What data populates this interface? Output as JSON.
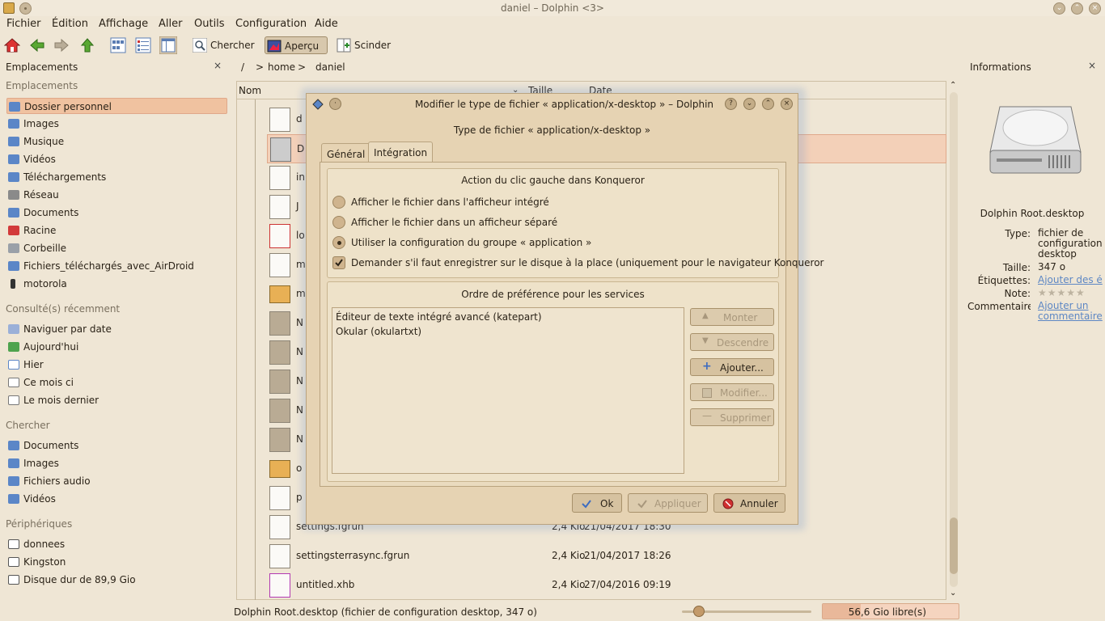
{
  "window": {
    "title": "daniel – Dolphin <3>"
  },
  "menu": [
    "Fichier",
    "Édition",
    "Affichage",
    "Aller",
    "Outils",
    "Configuration",
    "Aide"
  ],
  "toolbar": {
    "search": "Chercher",
    "preview": "Aperçu",
    "split": "Scinder"
  },
  "left_panel": {
    "title": "Emplacements",
    "close": "×",
    "sections": {
      "places": "Emplacements",
      "recent": "Consulté(s) récemment",
      "search": "Chercher",
      "devices": "Périphériques"
    },
    "places": [
      "Dossier personnel",
      "Images",
      "Musique",
      "Vidéos",
      "Téléchargements",
      "Réseau",
      "Documents",
      "Racine",
      "Corbeille",
      "Fichiers_téléchargés_avec_AirDroid",
      "motorola"
    ],
    "recent": [
      "Naviguer par date",
      "Aujourd'hui",
      "Hier",
      "Ce mois ci",
      "Le mois dernier"
    ],
    "search": [
      "Documents",
      "Images",
      "Fichiers audio",
      "Vidéos"
    ],
    "devices": [
      "donnees",
      "Kingston",
      "Disque dur de 89,9 Gio"
    ]
  },
  "breadcrumb": [
    "/",
    ">",
    "home",
    ">",
    "daniel"
  ],
  "columns": {
    "name": "Nom",
    "size": "Taille",
    "date": "Date"
  },
  "files": [
    {
      "name": "settings.fgrun",
      "size": "2,4 Kio",
      "date": "21/04/2017 18:30"
    },
    {
      "name": "settingsterrasync.fgrun",
      "size": "2,4 Kio",
      "date": "21/04/2017 18:26"
    },
    {
      "name": "untitled.xhb",
      "size": "2,4 Kio",
      "date": "27/04/2016 09:19"
    }
  ],
  "partial_names": [
    "d",
    "D",
    "in",
    "J",
    "lo",
    "m",
    "m",
    "N",
    "N",
    "N",
    "N",
    "N",
    "o",
    "p"
  ],
  "right_panel": {
    "title": "Informations",
    "close": "×",
    "filename": "Dolphin Root.desktop",
    "type_k": "Type:",
    "type_v": "fichier de configuration desktop",
    "size_k": "Taille:",
    "size_v": "347 o",
    "tags_k": "Étiquettes:",
    "tags_v": "Ajouter des é",
    "rating_k": "Note:",
    "rating": 0,
    "comment_k": "Commentaire:",
    "comment_v": "Ajouter un commentaire"
  },
  "status": {
    "text": "Dolphin Root.desktop (fichier de configuration desktop, 347 o)",
    "free": "56,6 Gio libre(s)"
  },
  "dialog": {
    "title": "Modifier le type de fichier « application/x-desktop » – Dolphin",
    "subtitle": "Type de fichier « application/x-desktop »",
    "tabs": [
      "Général",
      "Intégration"
    ],
    "action_group": "Action du clic gauche dans Konqueror",
    "options": [
      "Afficher le fichier dans l'afficheur intégré",
      "Afficher le fichier dans un afficheur séparé",
      "Utiliser la configuration du groupe « application »"
    ],
    "checkbox": "Demander s'il faut enregistrer sur le disque à la place (uniquement pour le navigateur Konqueror",
    "services_group": "Ordre de préférence pour les services",
    "services": [
      "Éditeur de texte intégré avancé (katepart)",
      "Okular (okulartxt)"
    ],
    "service_buttons": [
      "Monter",
      "Descendre",
      "Ajouter...",
      "Modifier...",
      "Supprimer"
    ],
    "ok": "Ok",
    "apply": "Appliquer",
    "cancel": "Annuler"
  }
}
